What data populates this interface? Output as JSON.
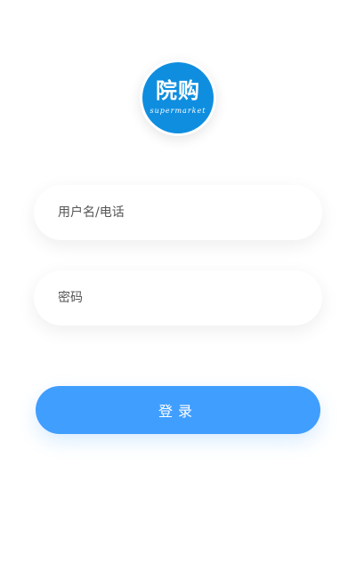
{
  "logo": {
    "main_text": "院购",
    "sub_text": "supermarket"
  },
  "form": {
    "username_placeholder": "用户名/电话",
    "password_placeholder": "密码",
    "login_label": "登录"
  },
  "colors": {
    "logo_bg": "#0f8ee0",
    "button_bg": "#409eff",
    "page_bg": "#ffffff"
  }
}
